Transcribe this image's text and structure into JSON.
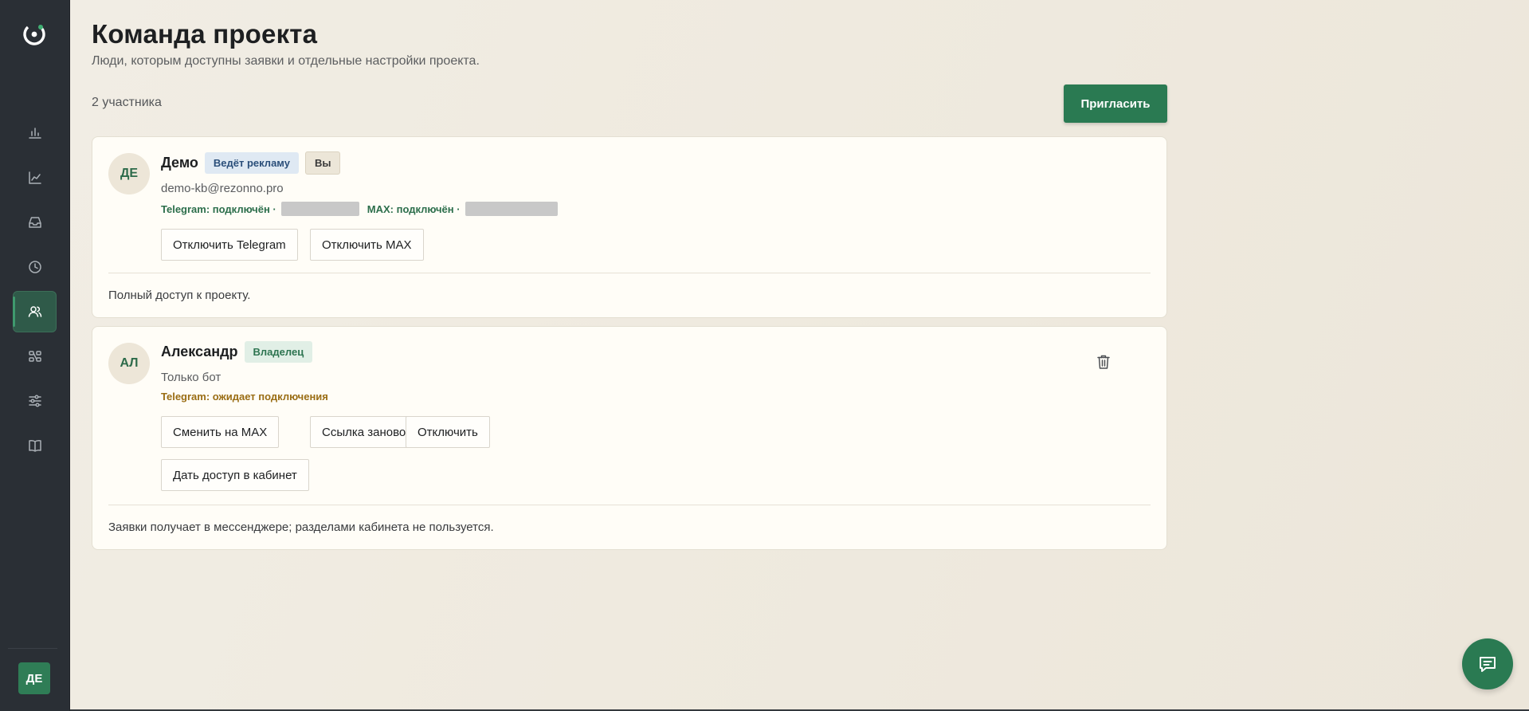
{
  "header": {
    "title": "Команда проекта",
    "subtitle": "Люди, которым доступны заявки и отдельные настройки проекта.",
    "member_count": "2 участника",
    "invite_label": "Пригласить"
  },
  "sidebar": {
    "items": [
      {
        "icon": "bar-chart-icon"
      },
      {
        "icon": "line-chart-icon"
      },
      {
        "icon": "inbox-icon"
      },
      {
        "icon": "clock-icon"
      },
      {
        "icon": "users-icon",
        "active": true
      },
      {
        "icon": "integrations-icon"
      },
      {
        "icon": "sliders-icon"
      },
      {
        "icon": "book-icon"
      }
    ],
    "user_initials": "ДЕ"
  },
  "members": [
    {
      "initials": "ДЕ",
      "name": "Демо",
      "badges": [
        "Ведёт рекламу",
        "Вы"
      ],
      "subtitle": "demo-kb@rezonno.pro",
      "status_telegram": "Telegram: подключён ·",
      "status_max": "MAX: подключён ·",
      "actions": [
        "Отключить Telegram",
        "Отключить MAX"
      ],
      "note": "Полный доступ к проекту."
    },
    {
      "initials": "АЛ",
      "name": "Александр",
      "badges": [
        "Владелец"
      ],
      "subtitle": "Только бот",
      "status_telegram": "Telegram: ожидает подключения",
      "actions": [
        "Сменить на MAX",
        "Ссылка заново",
        "Отключить",
        "Дать доступ в кабинет"
      ],
      "note": "Заявки получает в мессенджере; разделами кабинета не пользуется."
    }
  ],
  "colors": {
    "accent": "#2a7a52",
    "sidebar_bg": "#2a2f35",
    "status_ok": "#2c6e4b",
    "status_wait": "#9a6d14"
  }
}
